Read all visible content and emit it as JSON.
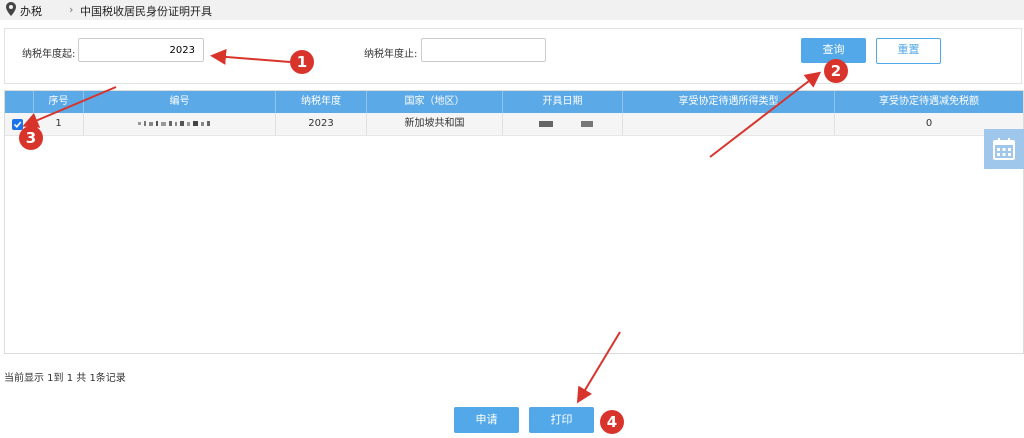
{
  "breadcrumb": {
    "root": "办税",
    "separator": "›",
    "current": "中国税收居民身份证明开具"
  },
  "filters": {
    "start_label": "纳税年度起:",
    "start_value": "2023",
    "end_label": "纳税年度止:",
    "end_value": ""
  },
  "buttons": {
    "query": "查询",
    "reset": "重置",
    "apply": "申请",
    "print": "打印"
  },
  "table": {
    "headers": [
      "序号",
      "编号",
      "纳税年度",
      "国家（地区）",
      "开具日期",
      "享受协定待遇所得类型",
      "享受协定待遇减免税额"
    ],
    "rows": [
      {
        "checked": true,
        "index": "1",
        "number": "",
        "year": "2023",
        "country": "新加坡共和国",
        "date": "",
        "income_type": "",
        "exempt_amount": "0"
      }
    ]
  },
  "footer": {
    "summary": "当前显示 1到 1 共 1条记录"
  },
  "annotations": [
    "1",
    "2",
    "3",
    "4"
  ],
  "icons": {
    "location": "map-pin-icon",
    "calendar": "calendar-icon",
    "checkbox": "checkmark-icon"
  },
  "colors": {
    "primary": "#52a8e8",
    "annotation": "#d9342b"
  }
}
